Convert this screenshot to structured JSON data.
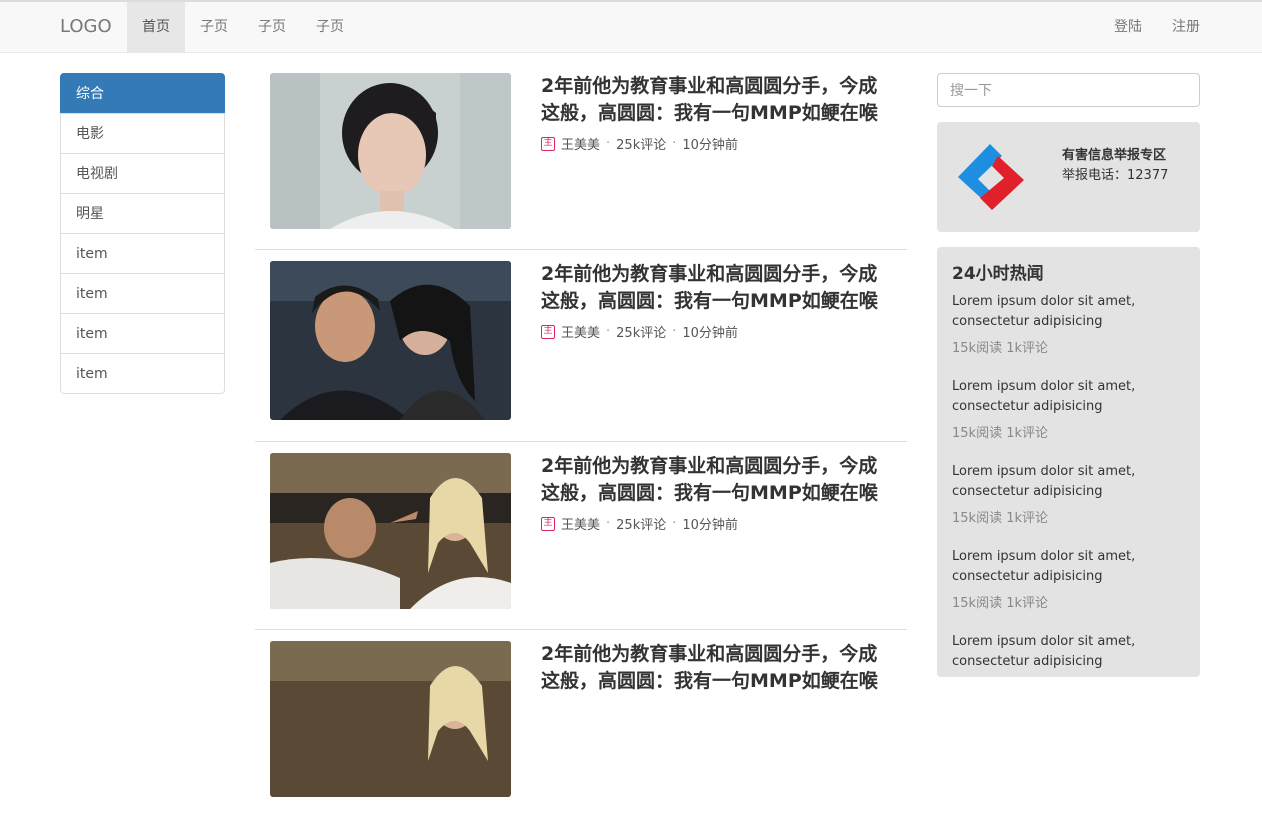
{
  "navbar": {
    "brand": "LOGO",
    "items": [
      {
        "label": "首页",
        "active": true
      },
      {
        "label": "子页"
      },
      {
        "label": "子页"
      },
      {
        "label": "子页"
      }
    ],
    "login": "登陆",
    "register": "注册"
  },
  "sidebar": {
    "items": [
      {
        "label": "综合",
        "active": true
      },
      {
        "label": "电影"
      },
      {
        "label": "电视剧"
      },
      {
        "label": "明星"
      },
      {
        "label": "item"
      },
      {
        "label": "item"
      },
      {
        "label": "item"
      },
      {
        "label": "item"
      }
    ]
  },
  "feed": {
    "items": [
      {
        "title": "2年前他为教育事业和高圆圆分手，今成这般，高圆圆：我有一句MMP如鲠在喉",
        "author": "王美美",
        "comments": "25k评论",
        "time": "10分钟前"
      },
      {
        "title": "2年前他为教育事业和高圆圆分手，今成这般，高圆圆：我有一句MMP如鲠在喉",
        "author": "王美美",
        "comments": "25k评论",
        "time": "10分钟前"
      },
      {
        "title": "2年前他为教育事业和高圆圆分手，今成这般，高圆圆：我有一句MMP如鲠在喉",
        "author": "王美美",
        "comments": "25k评论",
        "time": "10分钟前"
      },
      {
        "title": "2年前他为教育事业和高圆圆分手，今成这般，高圆圆：我有一句MMP如鲠在喉",
        "author": "",
        "comments": "",
        "time": ""
      }
    ]
  },
  "search": {
    "placeholder": "搜一下"
  },
  "report": {
    "title": "有害信息举报专区",
    "phone": "举报电话：12377"
  },
  "hot": {
    "title": "24小时热闻",
    "items": [
      {
        "text": "Lorem ipsum dolor sit amet, consectetur adipisicing",
        "stats": "15k阅读 1k评论"
      },
      {
        "text": "Lorem ipsum dolor sit amet, consectetur adipisicing",
        "stats": "15k阅读 1k评论"
      },
      {
        "text": "Lorem ipsum dolor sit amet, consectetur adipisicing",
        "stats": "15k阅读 1k评论"
      },
      {
        "text": "Lorem ipsum dolor sit amet, consectetur adipisicing",
        "stats": "15k阅读 1k评论"
      },
      {
        "text": "Lorem ipsum dolor sit amet, consectetur adipisicing",
        "stats": ""
      }
    ]
  },
  "colors": {
    "accent": "#337ab7",
    "meta_icon": "#e0245e",
    "panel_bg": "#e3e3e3"
  }
}
